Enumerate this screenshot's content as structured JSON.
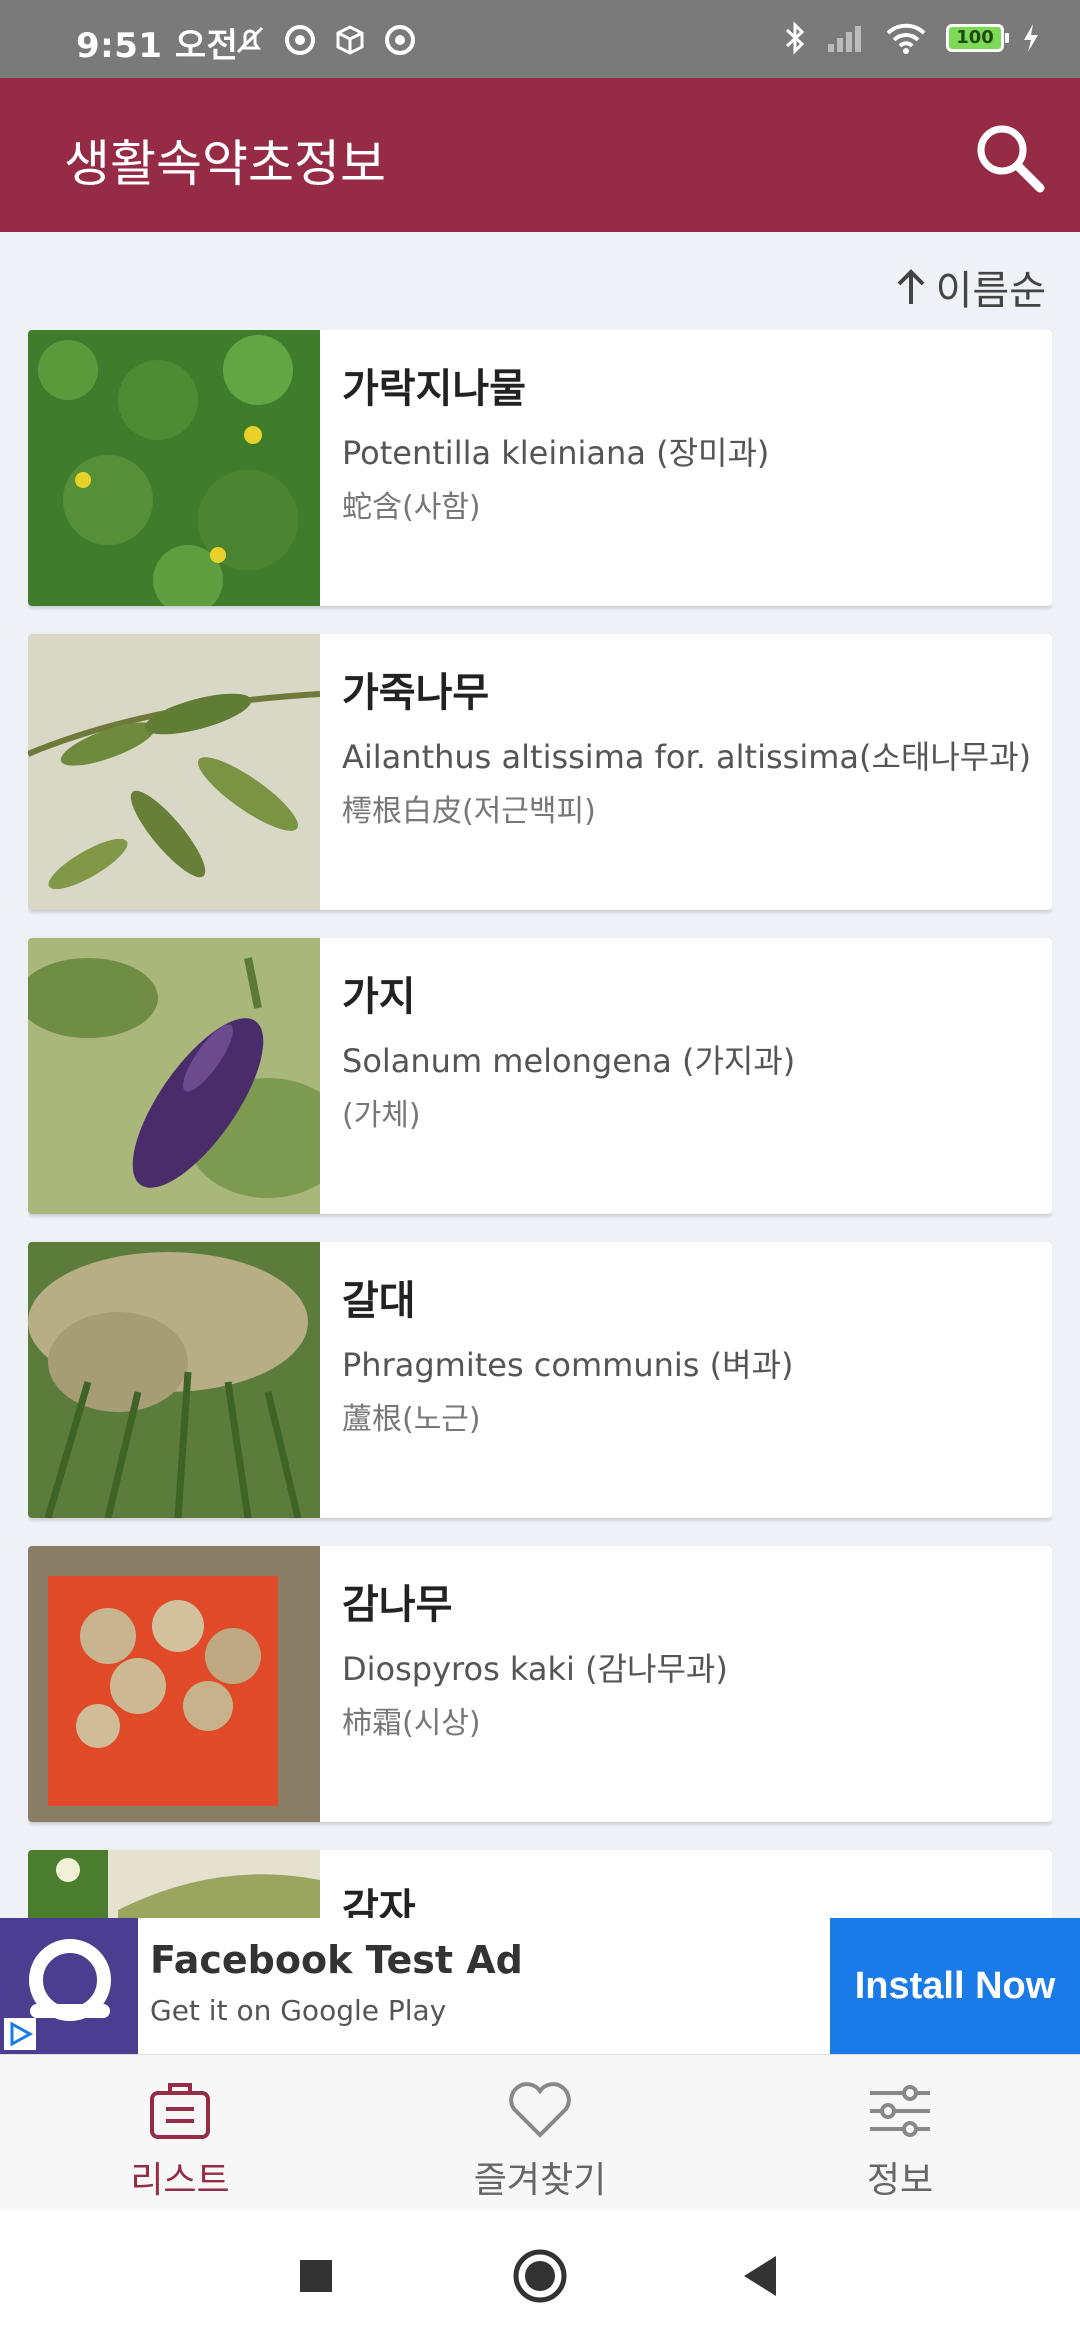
{
  "status_bar": {
    "time": "9:51 오전",
    "battery": "100"
  },
  "app_bar": {
    "title": "생활속약초정보"
  },
  "sort": {
    "label": "이름순"
  },
  "plants": [
    {
      "name": "가락지나물",
      "scientific": "Potentilla kleiniana (장미과)",
      "herb": "蛇含(사함)"
    },
    {
      "name": "가죽나무",
      "scientific": "Ailanthus altissima for. altissima(소태나무과)",
      "herb": "樗根白皮(저근백피)"
    },
    {
      "name": "가지",
      "scientific": "Solanum melongena (가지과)",
      "herb": "(가체)"
    },
    {
      "name": "갈대",
      "scientific": "Phragmites communis (벼과)",
      "herb": "蘆根(노근)"
    },
    {
      "name": "감나무",
      "scientific": "Diospyros kaki (감나무과)",
      "herb": "柿霜(시상)"
    },
    {
      "name": "감자",
      "scientific": "",
      "herb": ""
    }
  ],
  "ad": {
    "title": "Facebook Test Ad",
    "subtitle": "Get it on Google Play",
    "button": "Install Now"
  },
  "bottom_nav": {
    "list": "리스트",
    "favorites": "즐겨찾기",
    "info": "정보"
  },
  "colors": {
    "primary": "#962b46",
    "ad_button": "#1a7ae8",
    "status_bar": "#7a7a7a"
  }
}
